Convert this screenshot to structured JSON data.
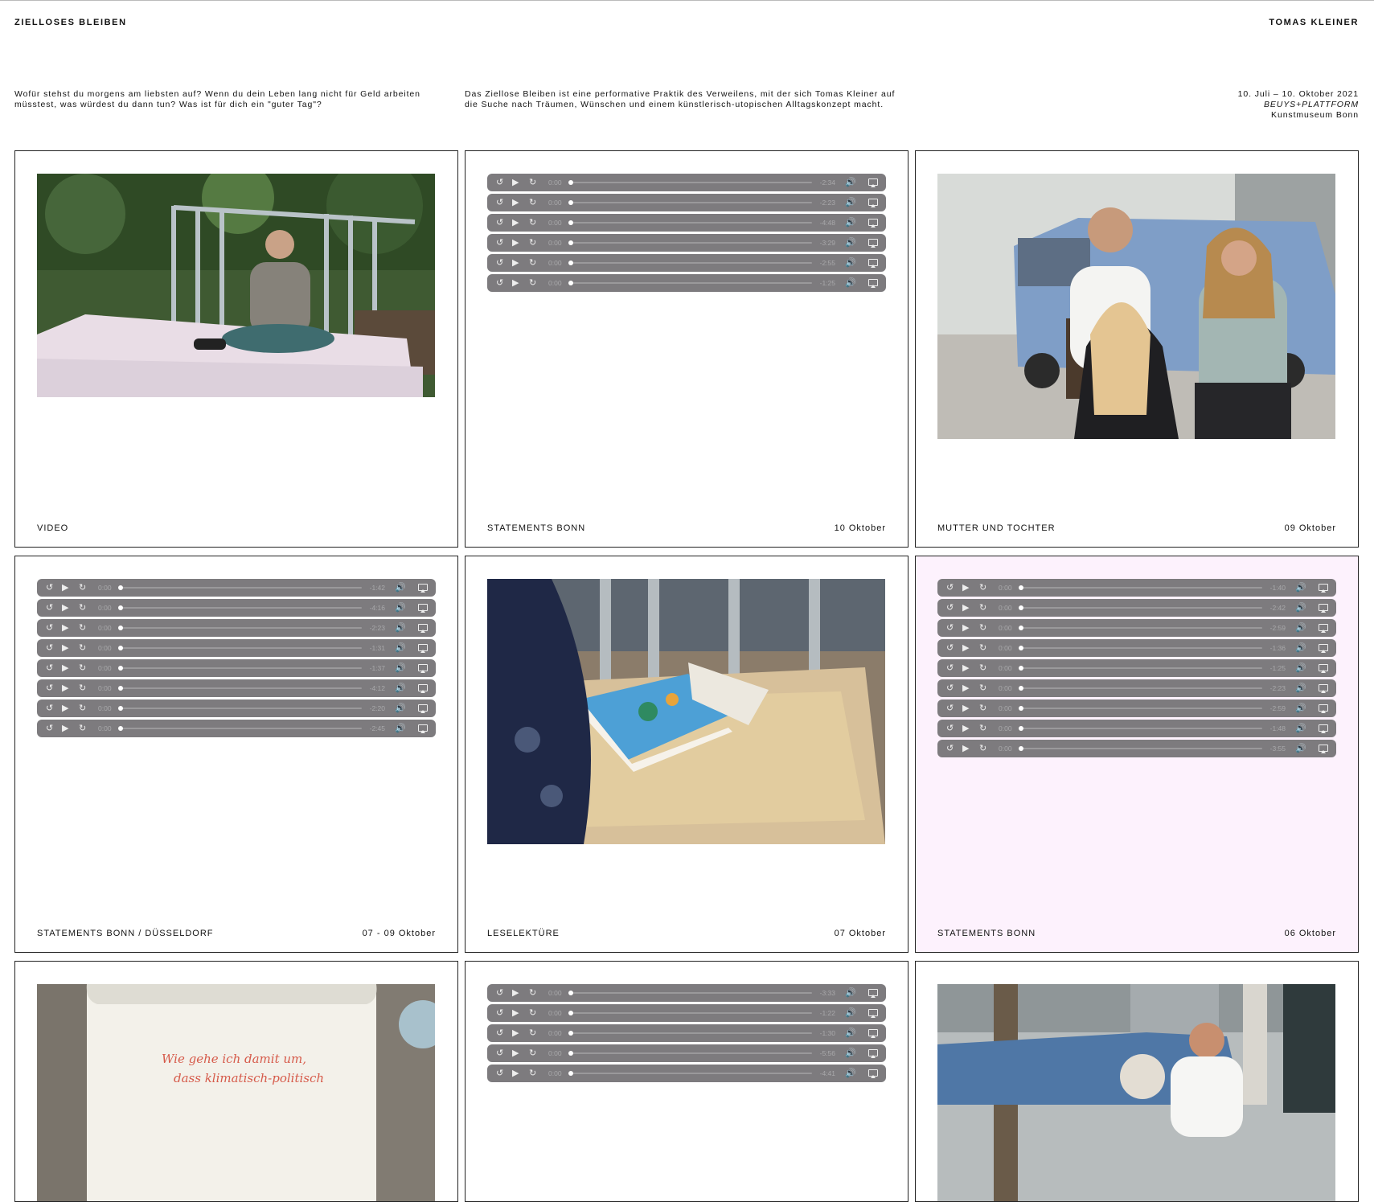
{
  "header": {
    "site_title": "ZIELLOSES BLEIBEN",
    "artist": "TOMAS KLEINER"
  },
  "intro": {
    "question": "Wofür stehst du morgens am liebsten auf? Wenn du dein Leben lang nicht für Geld arbeiten müsstest, was würdest du dann tun? Was ist für dich ein \"guter Tag\"?",
    "description": "Das Ziellose Bleiben ist eine performative Praktik des Verweilens, mit der sich Tomas Kleiner auf die Suche nach Träumen, Wünschen und einem künstlerisch-utopischen Alltagskonzept macht.",
    "dates": "10. Juli – 10. Oktober 2021",
    "venue": "BEUYS+PLATTFORM",
    "museum": "Kunstmuseum Bonn"
  },
  "player_current": "0:00",
  "cards": [
    {
      "title": "VIDEO",
      "date": ""
    },
    {
      "title": "STATEMENTS BONN",
      "date": "10 Oktober",
      "players": [
        "-2:34",
        "-2:23",
        "-4:48",
        "-3:29",
        "-2:55",
        "-1:25"
      ]
    },
    {
      "title": "MUTTER UND TOCHTER",
      "date": "09 Oktober"
    },
    {
      "title": "STATEMENTS BONN / DÜSSELDORF",
      "date": "07 - 09 Oktober",
      "players": [
        "-1:42",
        "-4:16",
        "-2:23",
        "-1:31",
        "-1:37",
        "-4:12",
        "-2:20",
        "-2:45"
      ]
    },
    {
      "title": "LESELEKTÜRE",
      "date": "07 Oktober"
    },
    {
      "title": "STATEMENTS BONN",
      "date": "06 Oktober",
      "players": [
        "-1:40",
        "-2:42",
        "-2:59",
        "-1:36",
        "-1:25",
        "-2:23",
        "-2:59",
        "-1:48",
        "-3:55"
      ]
    },
    {
      "title": "",
      "date": "",
      "handwriting": [
        "Wie gehe ich damit um,",
        "dass klimatisch-politisch"
      ]
    },
    {
      "title": "",
      "date": "",
      "players": [
        "-3:33",
        "-1:22",
        "-1:30",
        "-5:56",
        "-4:41"
      ]
    },
    {
      "title": "",
      "date": ""
    }
  ]
}
